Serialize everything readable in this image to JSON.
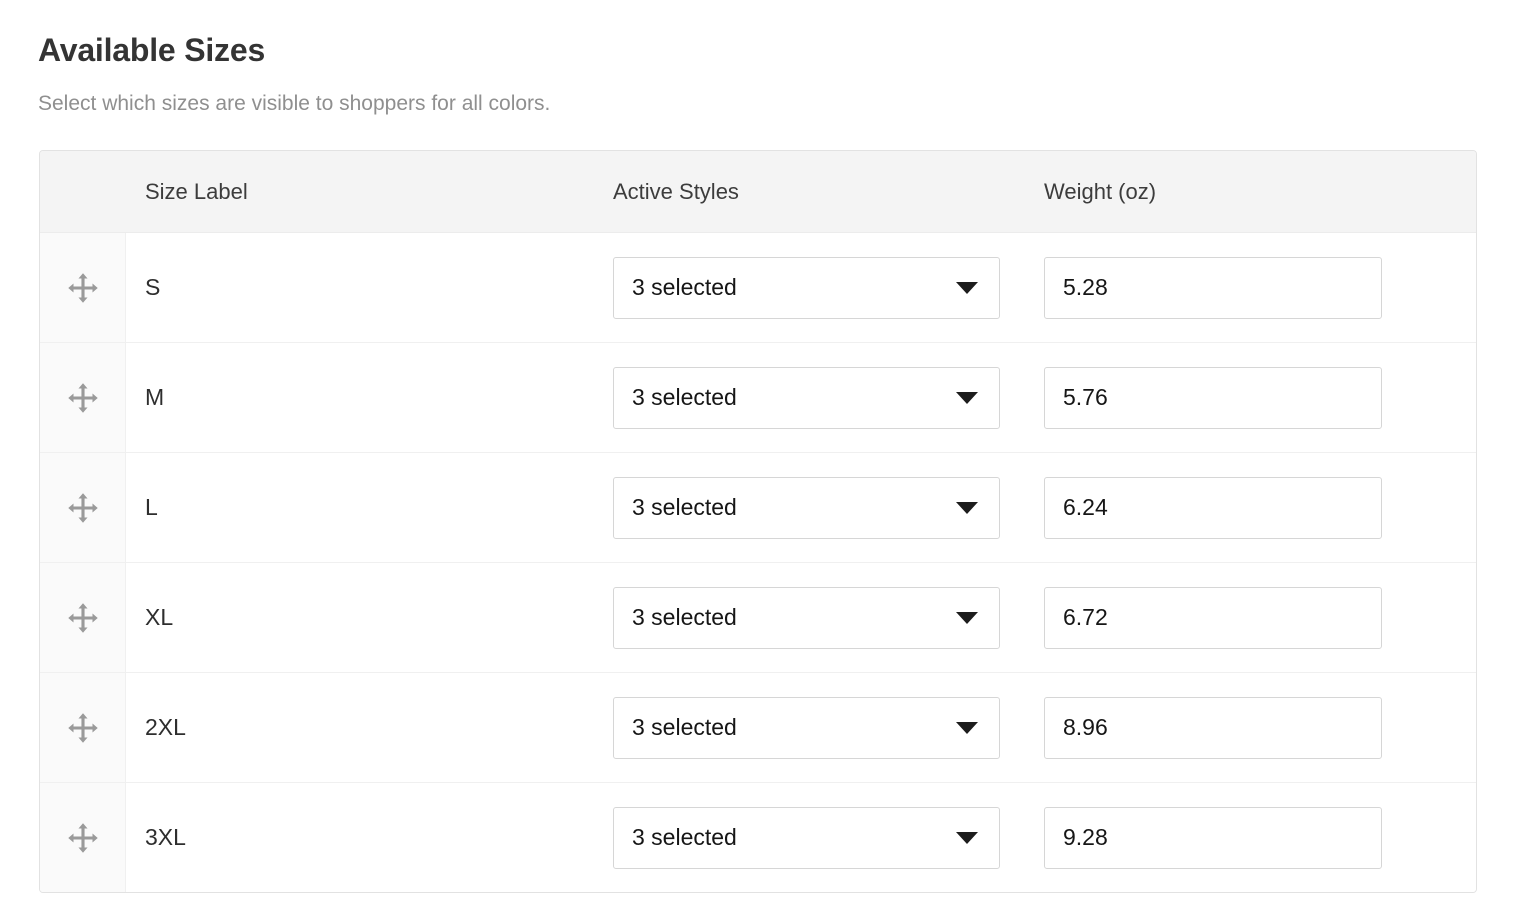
{
  "header": {
    "title": "Available Sizes",
    "subtitle": "Select which sizes are visible to shoppers for all colors."
  },
  "table": {
    "columns": {
      "drag": "",
      "size_label": "Size Label",
      "active_styles": "Active Styles",
      "weight": "Weight (oz)"
    },
    "rows": [
      {
        "drag_icon": "move-icon",
        "size_label": "S",
        "active_styles": "3 selected",
        "weight": "5.28"
      },
      {
        "drag_icon": "move-icon",
        "size_label": "M",
        "active_styles": "3 selected",
        "weight": "5.76"
      },
      {
        "drag_icon": "move-icon",
        "size_label": "L",
        "active_styles": "3 selected",
        "weight": "6.24"
      },
      {
        "drag_icon": "move-icon",
        "size_label": "XL",
        "active_styles": "3 selected",
        "weight": "6.72"
      },
      {
        "drag_icon": "move-icon",
        "size_label": "2XL",
        "active_styles": "3 selected",
        "weight": "8.96"
      },
      {
        "drag_icon": "move-icon",
        "size_label": "3XL",
        "active_styles": "3 selected",
        "weight": "9.28"
      }
    ]
  },
  "colors": {
    "title_text": "#343434",
    "subtitle_text": "#8f8f8f",
    "table_border": "#e2e2e2",
    "header_background": "#f4f4f4",
    "row_divider": "#f0f0f0",
    "drag_column_background": "#fafafa",
    "drag_icon": "#9a9a9a",
    "control_border": "#d6d6d6",
    "control_text": "#161616",
    "caret": "#1c1c1c"
  }
}
